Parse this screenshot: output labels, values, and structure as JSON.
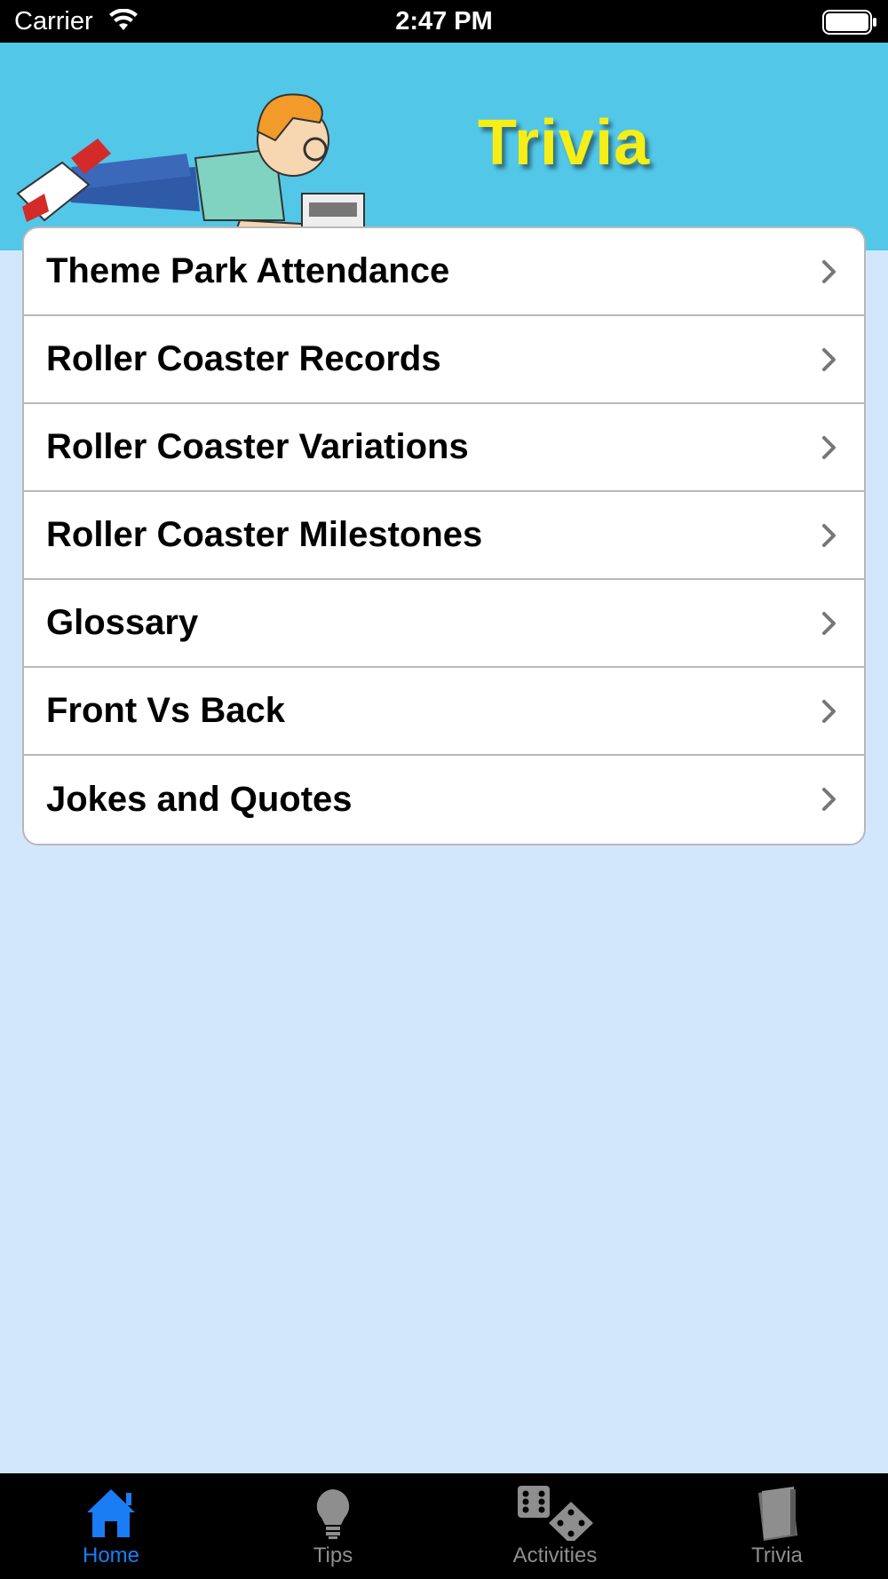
{
  "status_bar": {
    "carrier": "Carrier",
    "time": "2:47 PM"
  },
  "header": {
    "title": "Trivia"
  },
  "list": {
    "items": [
      {
        "label": "Theme Park Attendance"
      },
      {
        "label": "Roller Coaster Records"
      },
      {
        "label": "Roller Coaster Variations"
      },
      {
        "label": "Roller Coaster Milestones"
      },
      {
        "label": "Glossary"
      },
      {
        "label": "Front Vs Back"
      },
      {
        "label": "Jokes and Quotes"
      }
    ]
  },
  "tab_bar": {
    "tabs": [
      {
        "label": "Home",
        "icon": "home-icon",
        "active": true
      },
      {
        "label": "Tips",
        "icon": "lightbulb-icon",
        "active": false
      },
      {
        "label": "Activities",
        "icon": "dice-icon",
        "active": false
      },
      {
        "label": "Trivia",
        "icon": "book-icon",
        "active": false
      }
    ]
  },
  "colors": {
    "accent": "#1a7df5",
    "header_bg": "#52c7e8",
    "page_bg": "#d3e7fc",
    "title": "#f6ee16"
  }
}
